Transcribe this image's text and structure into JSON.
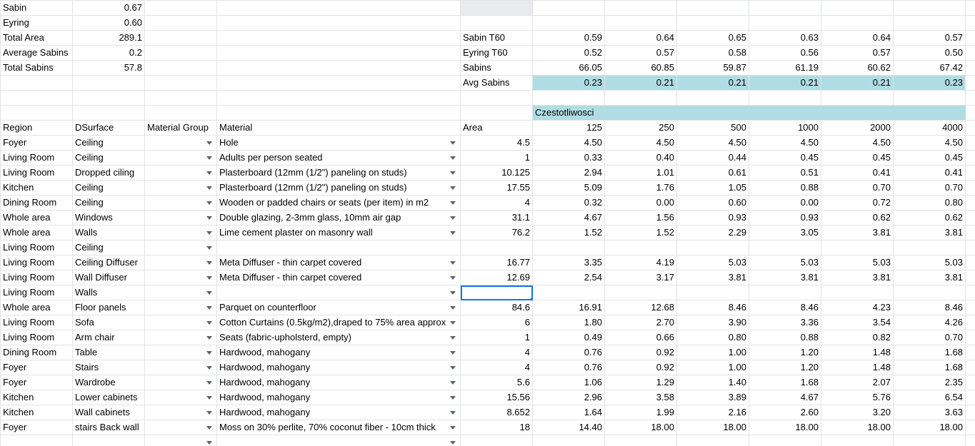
{
  "summary": {
    "sabin": {
      "label": "Sabin",
      "value": "0.67"
    },
    "eyring": {
      "label": "Eyring",
      "value": "0.60"
    },
    "total_area": {
      "label": "Total Area",
      "value": "289.1"
    },
    "average_sabins": {
      "label": "Average Sabins",
      "value": "0.2"
    },
    "total_sabins": {
      "label": "Total Sabins",
      "value": "57.8"
    }
  },
  "freq_summary": {
    "sabin_t60": {
      "label": "Sabin T60",
      "values": [
        "0.59",
        "0.64",
        "0.65",
        "0.63",
        "0.64",
        "0.57"
      ]
    },
    "eyring_t60": {
      "label": "Eyring T60",
      "values": [
        "0.52",
        "0.57",
        "0.58",
        "0.56",
        "0.57",
        "0.50"
      ]
    },
    "sabins": {
      "label": "Sabins",
      "values": [
        "66.05",
        "60.85",
        "59.87",
        "61.19",
        "60.62",
        "67.42"
      ]
    },
    "avg_sabins": {
      "label": "Avg Sabins",
      "values": [
        "0.23",
        "0.21",
        "0.21",
        "0.21",
        "0.21",
        "0.23"
      ]
    }
  },
  "frequency_header": "Czestotliwosci",
  "headers": {
    "region": "Region",
    "dsurface": "DSurface",
    "material_group": "Material Group",
    "material": "Material",
    "area": "Area",
    "frequencies": [
      "125",
      "250",
      "500",
      "1000",
      "2000",
      "4000"
    ]
  },
  "rows": [
    {
      "region": "Foyer",
      "surface": "Ceiling",
      "material": "Hole",
      "area": "4.5",
      "coef": [
        "4.50",
        "4.50",
        "4.50",
        "4.50",
        "4.50",
        "4.50"
      ]
    },
    {
      "region": "Living Room",
      "surface": "Ceiling",
      "material": "Adults per person seated",
      "area": "1",
      "coef": [
        "0.33",
        "0.40",
        "0.44",
        "0.45",
        "0.45",
        "0.45"
      ]
    },
    {
      "region": "Living Room",
      "surface": "Dropped ciling",
      "material": "Plasterboard (12mm (1/2\") paneling on studs)",
      "area": "10.125",
      "coef": [
        "2.94",
        "1.01",
        "0.61",
        "0.51",
        "0.41",
        "0.41"
      ]
    },
    {
      "region": "Kitchen",
      "surface": "Ceiling",
      "material": "Plasterboard (12mm (1/2\") paneling on studs)",
      "area": "17.55",
      "coef": [
        "5.09",
        "1.76",
        "1.05",
        "0.88",
        "0.70",
        "0.70"
      ]
    },
    {
      "region": "Dining Room",
      "surface": "Ceiling",
      "material": "Wooden or padded chairs or seats (per item) in m2",
      "area": "4",
      "coef": [
        "0.32",
        "0.00",
        "0.60",
        "0.00",
        "0.72",
        "0.80"
      ]
    },
    {
      "region": "Whole area",
      "surface": "Windows",
      "material": "Double glazing, 2-3mm glass, 10mm air gap",
      "area": "31.1",
      "coef": [
        "4.67",
        "1.56",
        "0.93",
        "0.93",
        "0.62",
        "0.62"
      ]
    },
    {
      "region": "Whole area",
      "surface": "Walls",
      "material": "Lime cement plaster on masonry wall",
      "area": "76.2",
      "coef": [
        "1.52",
        "1.52",
        "2.29",
        "3.05",
        "3.81",
        "3.81"
      ]
    },
    {
      "region": "Living Room",
      "surface": "Ceiling",
      "material": "",
      "area": "",
      "coef": [
        "",
        "",
        "",
        "",
        "",
        ""
      ],
      "no_material_dropdown": true
    },
    {
      "region": "Living Room",
      "surface": "Ceiling Diffuser",
      "material": "Meta Diffuser - thin carpet covered",
      "area": "16.77",
      "coef": [
        "3.35",
        "4.19",
        "5.03",
        "5.03",
        "5.03",
        "5.03"
      ]
    },
    {
      "region": "Living Room",
      "surface": "Wall Diffuser",
      "material": "Meta Diffuser - thin carpet covered",
      "area": "12.69",
      "coef": [
        "2.54",
        "3.17",
        "3.81",
        "3.81",
        "3.81",
        "3.81"
      ]
    },
    {
      "region": "Living Room",
      "surface": "Walls",
      "material": "",
      "area": "",
      "coef": [
        "",
        "",
        "",
        "",
        "",
        ""
      ],
      "selected_area": true
    },
    {
      "region": "Whole area",
      "surface": "Floor panels",
      "material": "Parquet on counterfloor",
      "area": "84.6",
      "coef": [
        "16.91",
        "12.68",
        "8.46",
        "8.46",
        "4.23",
        "8.46"
      ]
    },
    {
      "region": "Living Room",
      "surface": "Sofa",
      "material": "Cotton Curtains (0.5kg/m2),draped to 75% area approx",
      "area": "6",
      "coef": [
        "1.80",
        "2.70",
        "3.90",
        "3.36",
        "3.54",
        "4.26"
      ]
    },
    {
      "region": "Living Room",
      "surface": "Arm chair",
      "material": "Seats (fabric-upholsterd, empty)",
      "area": "1",
      "coef": [
        "0.49",
        "0.66",
        "0.80",
        "0.88",
        "0.82",
        "0.70"
      ]
    },
    {
      "region": "Dining Room",
      "surface": "Table",
      "material": "Hardwood, mahogany",
      "area": "4",
      "coef": [
        "0.76",
        "0.92",
        "1.00",
        "1.20",
        "1.48",
        "1.68"
      ]
    },
    {
      "region": "Foyer",
      "surface": "Stairs",
      "material": "Hardwood, mahogany",
      "area": "4",
      "coef": [
        "0.76",
        "0.92",
        "1.00",
        "1.20",
        "1.48",
        "1.68"
      ]
    },
    {
      "region": "Foyer",
      "surface": "Wardrobe",
      "material": "Hardwood, mahogany",
      "area": "5.6",
      "coef": [
        "1.06",
        "1.29",
        "1.40",
        "1.68",
        "2.07",
        "2.35"
      ]
    },
    {
      "region": "Kitchen",
      "surface": "Lower cabinets",
      "material": "Hardwood, mahogany",
      "area": "15.56",
      "coef": [
        "2.96",
        "3.58",
        "3.89",
        "4.67",
        "5.76",
        "6.54"
      ]
    },
    {
      "region": "Kitchen",
      "surface": "Wall cabinets",
      "material": "Hardwood, mahogany",
      "area": "8.652",
      "coef": [
        "1.64",
        "1.99",
        "2.16",
        "2.60",
        "3.20",
        "3.63"
      ]
    },
    {
      "region": "Foyer",
      "surface": "stairs Back wall",
      "material": "Moss on 30% perlite, 70% coconut fiber - 10cm thick",
      "area": "18",
      "coef": [
        "14.40",
        "18.00",
        "18.00",
        "18.00",
        "18.00",
        "18.00"
      ]
    },
    {
      "region": "",
      "surface": "",
      "material": "",
      "area": "",
      "coef": [
        "",
        "",
        "",
        "",
        "",
        ""
      ]
    }
  ]
}
